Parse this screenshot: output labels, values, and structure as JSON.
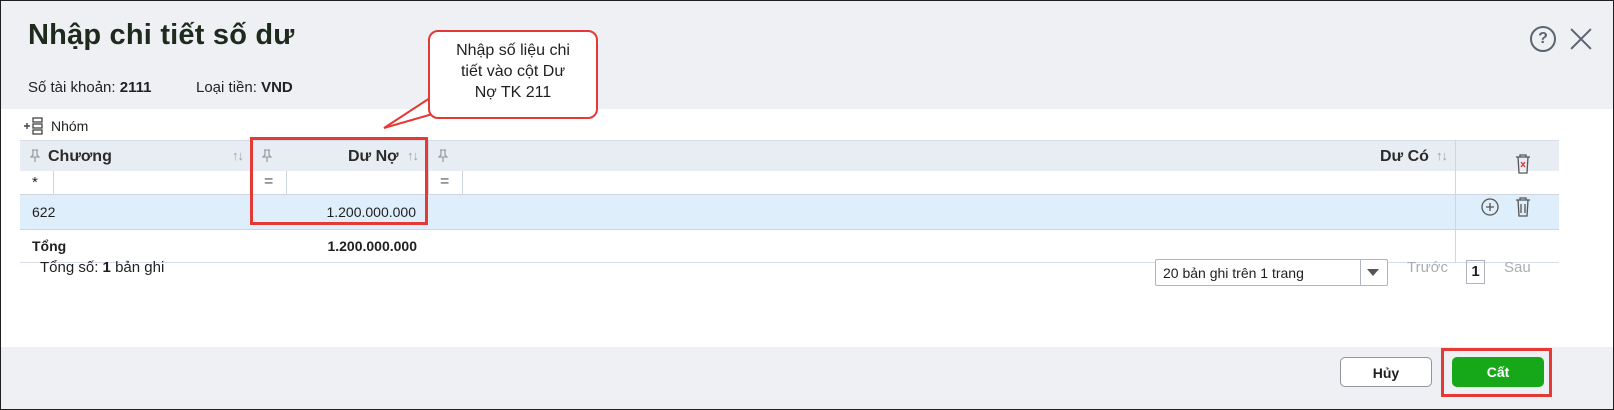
{
  "dialog": {
    "title": "Nhập chi tiết số dư"
  },
  "info": {
    "account_label": "Số tài khoản:",
    "account_value": "2111",
    "currency_label": "Loại tiền:",
    "currency_value": "VND"
  },
  "toolbar": {
    "group_label": "Nhóm"
  },
  "callout": {
    "lines": [
      "Nhập số liệu chi",
      "tiết vào cột Dư",
      "Nợ TK 211"
    ]
  },
  "grid": {
    "columns": [
      {
        "label": "Chương"
      },
      {
        "label": "Dư Nợ"
      },
      {
        "label": "Dư Có"
      }
    ],
    "filter": {
      "chuong_op": "*",
      "duno_op": "=",
      "duco_op": "="
    },
    "rows": [
      {
        "chuong": "622",
        "du_no": "1.200.000.000",
        "du_co": ""
      }
    ],
    "total": {
      "label": "Tổng",
      "du_no": "1.200.000.000"
    }
  },
  "pager": {
    "total_prefix": "Tổng số:",
    "total_count": "1",
    "total_suffix": "bản ghi",
    "page_size": "20 bản ghi trên 1 trang",
    "prev": "Trước",
    "page": "1",
    "next": "Sau"
  },
  "buttons": {
    "cancel": "Hủy",
    "save": "Cất"
  },
  "icons": {
    "help": "?",
    "filter_sort": "↑↓"
  },
  "colors": {
    "accent": "#17a81a",
    "highlight": "#e53935",
    "row_selected": "#deeefa"
  }
}
